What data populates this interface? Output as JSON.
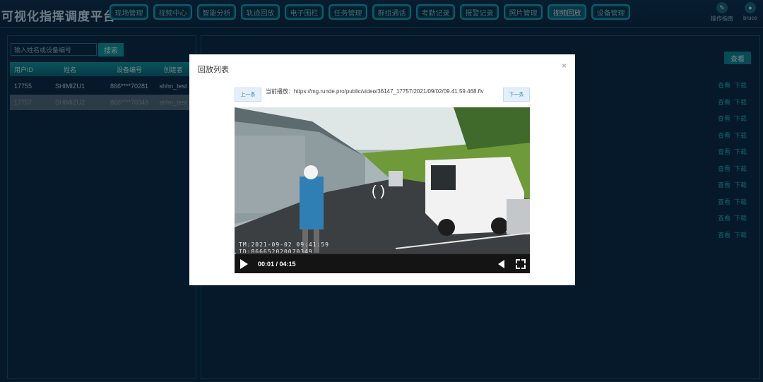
{
  "app": {
    "title": "可视化指挥调度平台"
  },
  "nav": {
    "items": [
      "现场管理",
      "视频中心",
      "智能分析",
      "轨迹回放",
      "电子围栏",
      "任务管理",
      "群组通话",
      "考勤记录",
      "报警记录",
      "照片管理",
      "视频回放",
      "设备管理"
    ],
    "active_index": 10
  },
  "header_right": {
    "ops_label": "操作指南",
    "user_name": "bruce"
  },
  "search": {
    "placeholder": "输入姓名或设备编号",
    "button_label": "搜索"
  },
  "device_table": {
    "headers": [
      "用户ID",
      "姓名",
      "设备编号",
      "创建者"
    ],
    "rows": [
      {
        "id": "17755",
        "name": "SHIMIZU1",
        "device": "866****70281",
        "creator": "shhn_test"
      },
      {
        "id": "17757",
        "name": "SHIMIZU2",
        "device": "866****70349",
        "creator": "shhn_test"
      }
    ],
    "selected_index": 1
  },
  "right_panel": {
    "button_label": "查看",
    "actions": [
      "查看",
      "下载"
    ],
    "row_count": 10
  },
  "dialog": {
    "title": "回放列表",
    "close_symbol": "×",
    "prev_label": "上一条",
    "next_label": "下一条",
    "current_label": "当前播放：",
    "current_url": "https://mg.runde.pro/public/video/36147_17757/2021/09/02/09.41.59.468.flv",
    "player": {
      "time": "00:01 / 04:15",
      "progress": 0.004,
      "osd_time": "TM:2021-09-02 09:41:59",
      "osd_id": "ID:866652020070349"
    }
  },
  "colors": {
    "accent": "#18b3c4",
    "background": "#0b2a44",
    "progress": "#2f9fd8"
  }
}
